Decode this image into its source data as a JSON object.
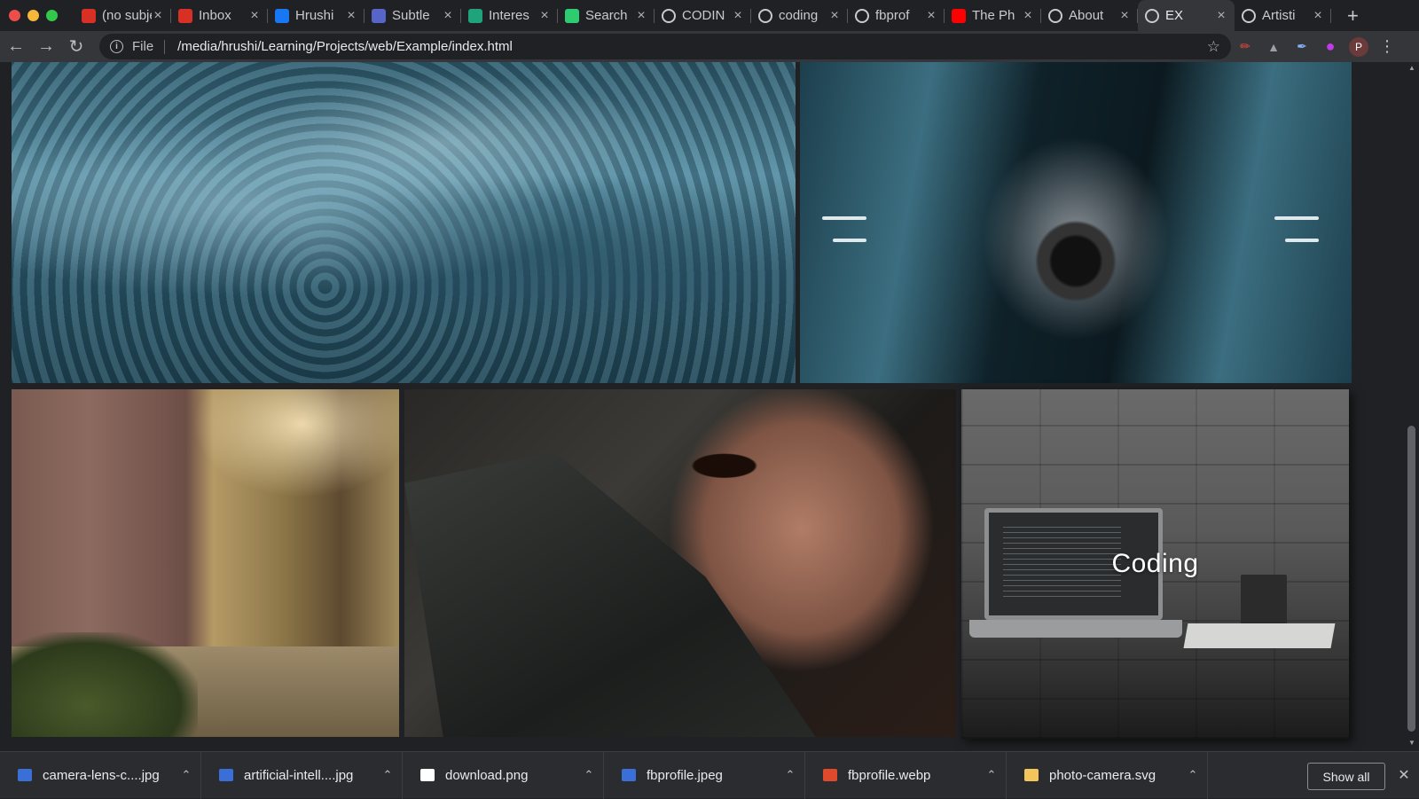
{
  "window": {
    "tabs": [
      {
        "title": "(no subject)",
        "favicon": "gmail-icon",
        "color": "#d93025",
        "active": false
      },
      {
        "title": "Inbox",
        "favicon": "gmail-icon",
        "color": "#d93025",
        "active": false
      },
      {
        "title": "Hrushi",
        "favicon": "facebook-icon",
        "color": "#1877f2",
        "active": false
      },
      {
        "title": "Subtle",
        "favicon": "subtle-icon",
        "color": "#5865c8",
        "active": false
      },
      {
        "title": "Interes",
        "favicon": "dev-icon",
        "color": "#1fa37a",
        "active": false
      },
      {
        "title": "Search",
        "favicon": "search-check-icon",
        "color": "#2ecc71",
        "active": false
      },
      {
        "title": "CODIN",
        "favicon": "google-icon",
        "color": "#ffffff",
        "active": false
      },
      {
        "title": "coding",
        "favicon": "google-icon",
        "color": "#ffffff",
        "active": false
      },
      {
        "title": "fbprof",
        "favicon": "globe-icon",
        "color": "#ffffff",
        "active": false
      },
      {
        "title": "The Ph",
        "favicon": "youtube-icon",
        "color": "#ff0000",
        "active": false
      },
      {
        "title": "About",
        "favicon": "google-icon",
        "color": "#ffffff",
        "active": false
      },
      {
        "title": "EX",
        "favicon": "globe-icon",
        "color": "#ffffff",
        "active": true
      },
      {
        "title": "Artisti",
        "favicon": "google-icon",
        "color": "#ffffff",
        "active": false
      }
    ],
    "new_tab_label": "+"
  },
  "toolbar": {
    "scheme_label": "File",
    "url": "/media/hrushi/Learning/Projects/web/Example/index.html",
    "avatar_letter": "P"
  },
  "page": {
    "gallery": [
      {
        "name": "water",
        "caption": ""
      },
      {
        "name": "camera",
        "caption": ""
      },
      {
        "name": "forest",
        "caption": ""
      },
      {
        "name": "face",
        "caption": ""
      },
      {
        "name": "coding",
        "caption": "Coding"
      }
    ]
  },
  "downloads": {
    "items": [
      {
        "name": "camera-lens-c....jpg",
        "icon": "image-file-icon",
        "color": "#3b6fd8"
      },
      {
        "name": "artificial-intell....jpg",
        "icon": "image-file-icon",
        "color": "#3b6fd8"
      },
      {
        "name": "download.png",
        "icon": "png-file-icon",
        "color": "#ffffff"
      },
      {
        "name": "fbprofile.jpeg",
        "icon": "image-file-icon",
        "color": "#3b6fd8"
      },
      {
        "name": "fbprofile.webp",
        "icon": "webp-file-icon",
        "color": "#e04a2c"
      },
      {
        "name": "photo-camera.svg",
        "icon": "svg-file-icon",
        "color": "#f4c55a"
      }
    ],
    "show_all_label": "Show all"
  }
}
